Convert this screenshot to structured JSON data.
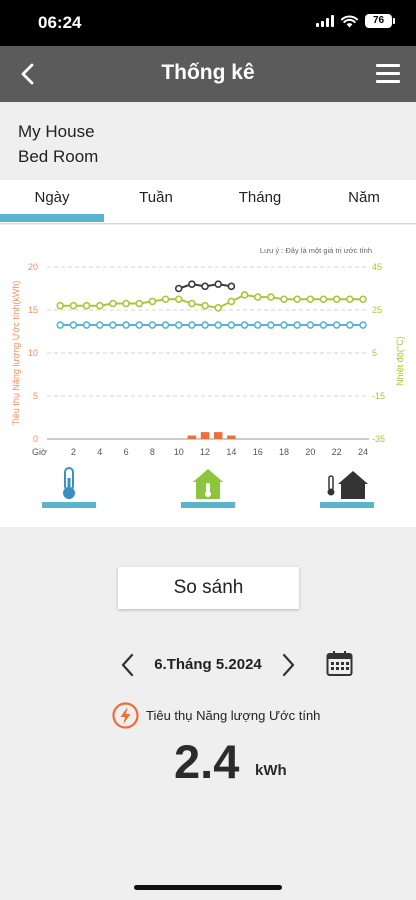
{
  "status": {
    "time": "06:24",
    "battery": "76"
  },
  "nav": {
    "title": "Thống kê"
  },
  "location": {
    "house": "My House",
    "room": "Bed Room"
  },
  "tabs": [
    {
      "label": "Ngày",
      "active": true
    },
    {
      "label": "Tuần",
      "active": false
    },
    {
      "label": "Tháng",
      "active": false
    },
    {
      "label": "Năm",
      "active": false
    }
  ],
  "compare_label": "So sánh",
  "date": "6.Tháng 5.2024",
  "energy": {
    "label": "Tiêu thụ Năng lượng Ước tính",
    "value": "2.4",
    "unit": "kWh"
  },
  "colors": {
    "accent": "#5ab4d0",
    "energy": "#f09060",
    "temperature": "#a9c63a",
    "setpoint_series": "#5ab4d0",
    "measured_series": "#3a3a3a",
    "bars": "#e8703a",
    "nav_bg": "#5b5b5b"
  },
  "modes": [
    {
      "name": "thermometer-icon"
    },
    {
      "name": "house-thermometer-icon"
    },
    {
      "name": "outdoor-house-icon"
    }
  ],
  "chart_data": {
    "type": "line",
    "note": "Lưu ý : Đây là một giá trị ước tính",
    "xlabel": "Giờ",
    "x_ticks": [
      "2",
      "4",
      "6",
      "8",
      "10",
      "12",
      "14",
      "16",
      "18",
      "20",
      "22",
      "24"
    ],
    "y_left": {
      "label": "Tiêu thụ Năng lượng Ước tính(kWh)",
      "ticks": [
        "20",
        "15",
        "10",
        "5",
        "0"
      ],
      "range": [
        0,
        20
      ]
    },
    "y_right": {
      "label": "Nhiệt độ(°C)",
      "ticks": [
        "45",
        "25",
        "5",
        "-15",
        "-35"
      ],
      "range": [
        -35,
        45
      ]
    },
    "grid": true,
    "series": [
      {
        "axis": "right",
        "color": "#5ab4d0",
        "x": [
          1,
          2,
          3,
          4,
          5,
          6,
          7,
          8,
          9,
          10,
          11,
          12,
          13,
          14,
          15,
          16,
          17,
          18,
          19,
          20,
          21,
          22,
          23,
          24
        ],
        "values": [
          18,
          18,
          18,
          18,
          18,
          18,
          18,
          18,
          18,
          18,
          18,
          18,
          18,
          18,
          18,
          18,
          18,
          18,
          18,
          18,
          18,
          18,
          18,
          18
        ]
      },
      {
        "axis": "right",
        "color": "#a9c63a",
        "x": [
          1,
          2,
          3,
          4,
          5,
          6,
          7,
          8,
          9,
          10,
          11,
          12,
          13,
          14,
          15,
          16,
          17,
          18,
          19,
          20,
          21,
          22,
          23,
          24
        ],
        "values": [
          27,
          27,
          27,
          27,
          28,
          28,
          28,
          29,
          30,
          30,
          28,
          27,
          26,
          29,
          32,
          31,
          31,
          30,
          30,
          30,
          30,
          30,
          30,
          30
        ]
      },
      {
        "axis": "right",
        "color": "#3a3a3a",
        "x": [
          10,
          11,
          12,
          13,
          14
        ],
        "values": [
          35,
          37,
          36,
          37,
          36
        ]
      }
    ],
    "bars": {
      "axis": "left",
      "color": "#e8703a",
      "x": [
        11,
        12,
        13,
        14
      ],
      "values": [
        0.4,
        0.8,
        0.8,
        0.4
      ]
    }
  }
}
